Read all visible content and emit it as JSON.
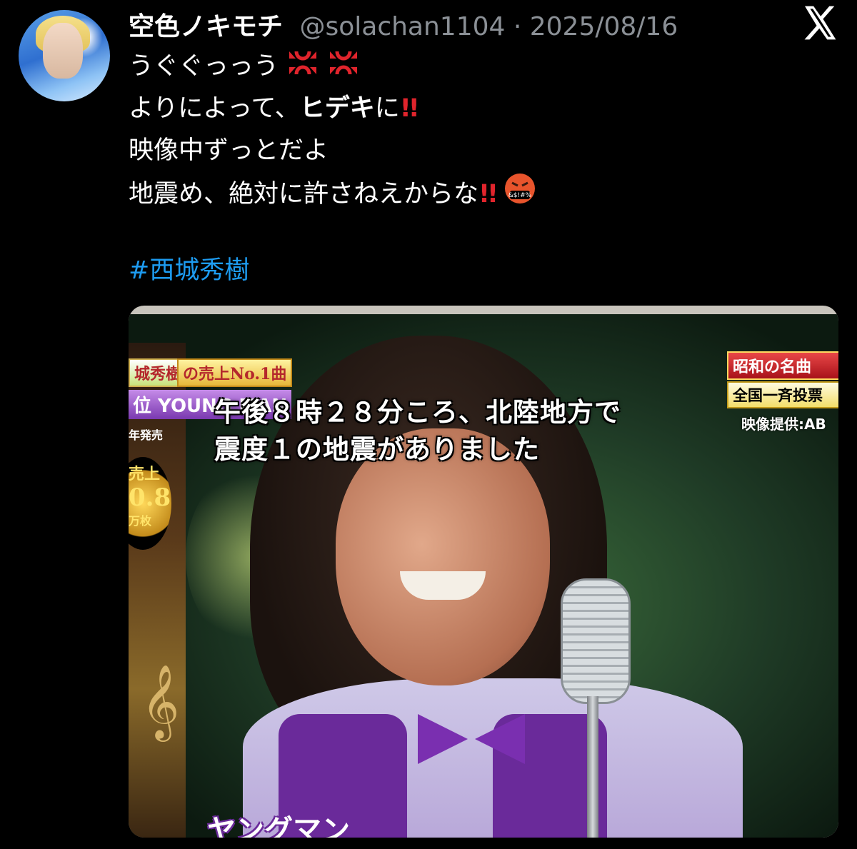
{
  "post": {
    "display_name": "空色ノキモチ",
    "meta": "@solachan1104 · 2025/08/16",
    "lines": [
      {
        "text": "うぐぐっっう",
        "emoji": "anger-symbol-x2"
      },
      {
        "text": "よりによって、",
        "bold": "ヒデキ",
        "tail": "に",
        "emoji": "double-exclamation"
      },
      {
        "text": "映像中ずっとだよ"
      },
      {
        "text": "地震め、絶対に許さねえからな",
        "emoji": "double-exclamation-and-cursing-face"
      }
    ],
    "hashtag": "#西城秀樹"
  },
  "media": {
    "overlay": {
      "top_left_1": "城秀樹",
      "top_left_1b": "の売上No.1曲",
      "top_left_2": "位 YOUNG MAN",
      "top_left_3": "年発売",
      "sales": [
        "売上",
        "0.8",
        "万枚"
      ],
      "top_right_1": "昭和の名曲",
      "top_right_2": "全国一斉投票",
      "credit": "映像提供:AB",
      "alert_line1": "午後８時２８分ころ、北陸地方で",
      "alert_line2": "震度１の地震がありました",
      "bottom": "ヤングマン"
    }
  },
  "icons": {
    "platform": "x-logo",
    "emoji_anger": "anger-symbol",
    "emoji_curse_text": "&$!#%"
  },
  "colors": {
    "link": "#1d9bf0",
    "meta": "#8b9096",
    "alert_red": "#e0242c"
  }
}
